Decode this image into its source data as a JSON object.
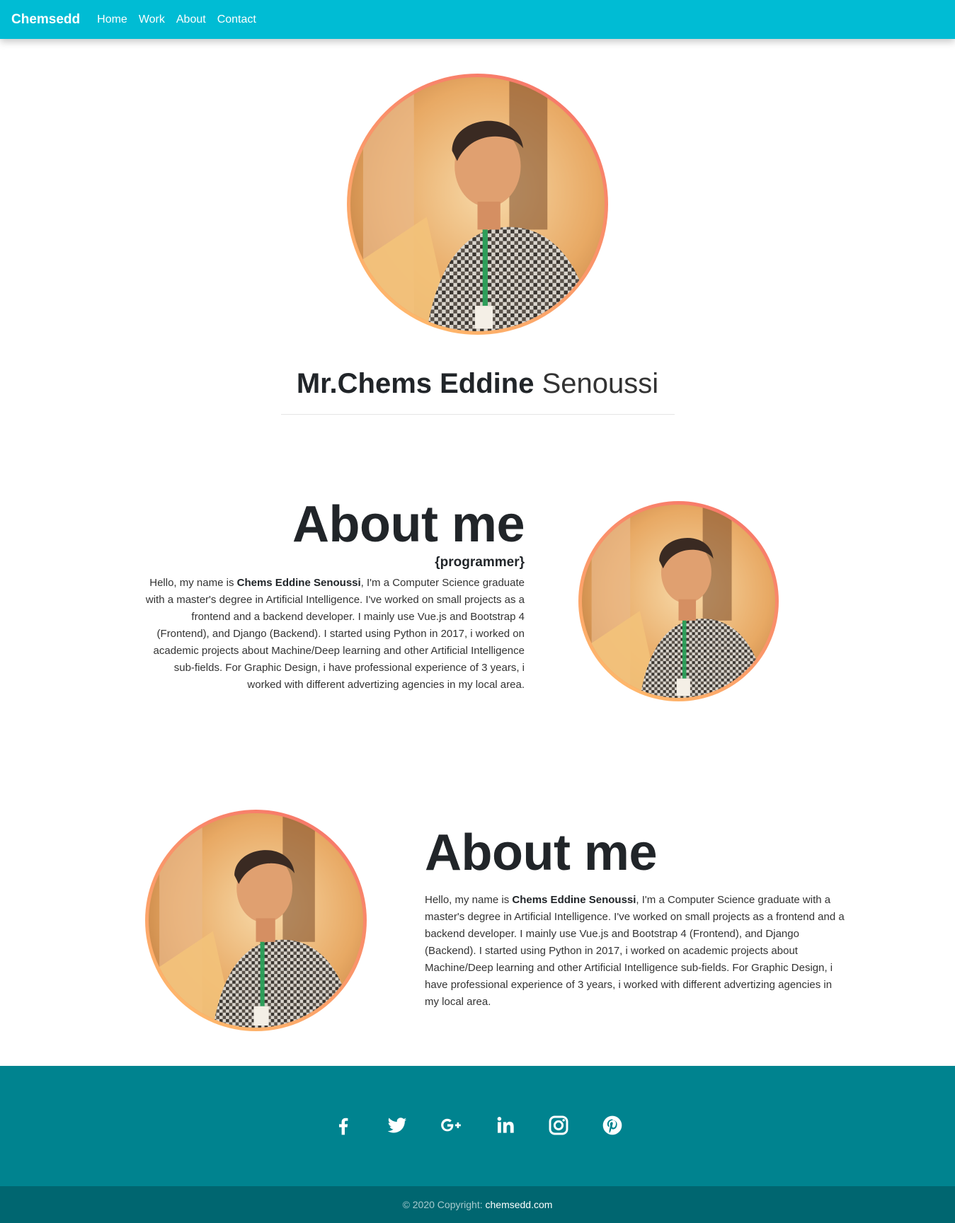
{
  "nav": {
    "brand": "Chemsedd",
    "links": [
      "Home",
      "Work",
      "About",
      "Contact"
    ]
  },
  "hero": {
    "name_bold": "Mr.Chems Eddine",
    "name_light": "Senoussi"
  },
  "about_primary": {
    "title": "About me",
    "subtitle": "{programmer}",
    "intro": "Hello, my name is ",
    "name": "Chems Eddine Senoussi",
    "body": ", I'm a Computer Science graduate with a master's degree in Artificial Intelligence. I've worked on small projects as a frontend and a backend developer. I mainly use Vue.js and Bootstrap 4 (Frontend), and Django (Backend). I started using Python in 2017, i worked on academic projects about Machine/Deep learning and other Artificial Intelligence sub-fields. For Graphic Design, i have professional experience of 3 years, i worked with different advertizing agencies in my local area."
  },
  "about_secondary": {
    "title": "About me",
    "intro": "Hello, my name is ",
    "name": "Chems Eddine Senoussi",
    "body": ", I'm a Computer Science graduate with a master's degree in Artificial Intelligence. I've worked on small projects as a frontend and a backend developer. I mainly use Vue.js and Bootstrap 4 (Frontend), and Django (Backend). I started using Python in 2017, i worked on academic projects about Machine/Deep learning and other Artificial Intelligence sub-fields. For Graphic Design, i have professional experience of 3 years, i worked with different advertizing agencies in my local area."
  },
  "footer": {
    "socials": [
      "facebook-icon",
      "twitter-icon",
      "google-plus-icon",
      "linkedin-icon",
      "instagram-icon",
      "pinterest-icon"
    ],
    "copyright_prefix": "© 2020 Copyright: ",
    "copyright_link": "chemsedd.com"
  },
  "colors": {
    "navbar": "#00bcd4",
    "footer": "#00838f",
    "footer_bottom": "#006670",
    "avatar_ring_start": "#ffc26b",
    "avatar_ring_end": "#f6706a"
  }
}
